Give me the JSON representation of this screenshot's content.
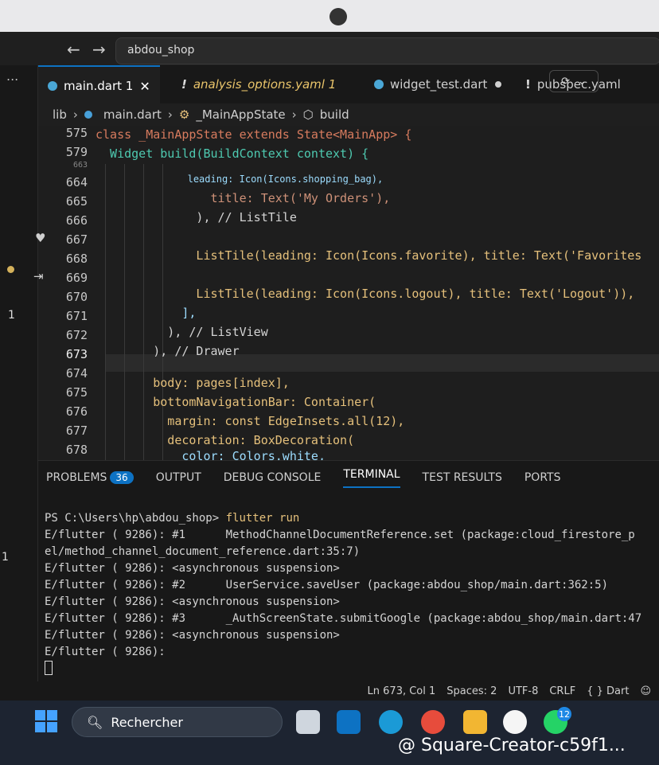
{
  "window": {
    "search_text": "abdou_shop"
  },
  "activity": {
    "dots": "...",
    "badge": "1",
    "badge2": "1"
  },
  "tabs": [
    {
      "label": "main.dart 1",
      "state": "active"
    },
    {
      "label": "analysis_options.yaml 1",
      "state": "warning"
    },
    {
      "label": "widget_test.dart",
      "state": "modified"
    },
    {
      "label": "pubspec.yaml",
      "state": "normal"
    }
  ],
  "breadcrumb": [
    "lib",
    "main.dart",
    "_MainAppState",
    "build"
  ],
  "editor": {
    "lines": [
      {
        "num": "575"
      },
      {
        "num": "579"
      },
      {
        "num": "663"
      },
      {
        "num": "664"
      },
      {
        "num": "665"
      },
      {
        "num": "666"
      },
      {
        "num": "667"
      },
      {
        "num": "668"
      },
      {
        "num": "669"
      },
      {
        "num": "670"
      },
      {
        "num": "671"
      },
      {
        "num": "672"
      },
      {
        "num": "673"
      },
      {
        "num": "674"
      },
      {
        "num": "675"
      },
      {
        "num": "676"
      },
      {
        "num": "677"
      },
      {
        "num": "678"
      }
    ],
    "code": {
      "l575": "class _MainAppState extends State<MainApp> {",
      "l579": "  Widget build(BuildContext context) {",
      "l664": "                leading: Icon(Icons.shopping_bag),",
      "l665": "                title: Text('My Orders'),",
      "l666": "              ), // ListTile",
      "l668": "              ListTile(leading: Icon(Icons.favorite), title: Text('Favorites",
      "l670": "              ListTile(leading: Icon(Icons.logout), title: Text('Logout')),",
      "l671": "            ],",
      "l672": "          ), // ListView",
      "l673": "        ), // Drawer",
      "l675": "        body: pages[index],",
      "l676": "        bottomNavigationBar: Container(",
      "l677": "          margin: const EdgeInsets.all(12),",
      "l678": "          decoration: BoxDecoration(",
      "l679": "            color: Colors.white,"
    }
  },
  "panel": {
    "tabs": [
      "PROBLEMS",
      "OUTPUT",
      "DEBUG CONSOLE",
      "TERMINAL",
      "TEST RESULTS",
      "PORTS"
    ],
    "problems_count": "36",
    "active_tab": "TERMINAL"
  },
  "terminal": {
    "prompt": "PS C:\\Users\\hp\\abdou_shop>",
    "command": "flutter run",
    "lines": [
      "E/flutter ( 9286): #1      MethodChannelDocumentReference.set (package:cloud_firestore_p",
      "el/method_channel_document_reference.dart:35:7)",
      "E/flutter ( 9286): <asynchronous suspension>",
      "E/flutter ( 9286): #2      UserService.saveUser (package:abdou_shop/main.dart:362:5)",
      "E/flutter ( 9286): <asynchronous suspension>",
      "E/flutter ( 9286): #3      _AuthScreenState.submitGoogle (package:abdou_shop/main.dart:47",
      "E/flutter ( 9286): <asynchronous suspension>",
      "E/flutter ( 9286):"
    ]
  },
  "status": {
    "position": "Ln 673, Col 1",
    "spaces": "Spaces: 2",
    "encoding": "UTF-8",
    "eol": "CRLF",
    "language": "{ } Dart"
  },
  "taskbar": {
    "search_placeholder": "Rechercher",
    "notification_badge": "12"
  },
  "watermark": "@ Square-Creator-c59f1...",
  "colors": {
    "accent": "#0d72c3",
    "keyword": "#d77b5e",
    "type": "#4ec9b0",
    "property": "#9cdcfe",
    "string": "#ce9178",
    "warning": "#e9c46a"
  }
}
